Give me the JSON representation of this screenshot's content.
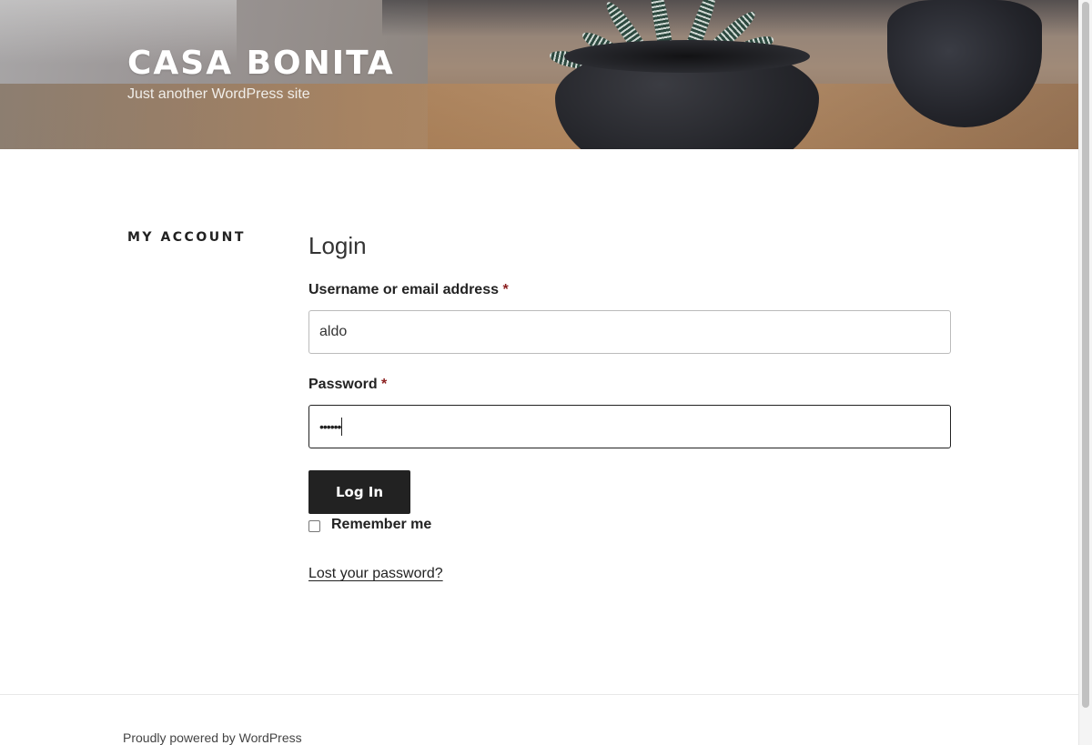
{
  "header": {
    "site_title": "CASA BONITA",
    "site_description": "Just another WordPress site"
  },
  "content": {
    "page_title": "MY ACCOUNT",
    "login_heading": "Login",
    "username_label": "Username or email address",
    "username_value": "aldo",
    "password_label": "Password",
    "password_masked": "••••••",
    "required_marker": "*",
    "login_button_label": "Log In",
    "remember_me_label": "Remember me",
    "remember_me_checked": false,
    "lost_password_link": "Lost your password?"
  },
  "footer": {
    "powered_by": "Proudly powered by WordPress"
  },
  "colors": {
    "button_bg": "#222222",
    "required_marker": "#8b1f1f",
    "text": "#222222"
  },
  "icons": {
    "checkbox": "checkbox-unchecked"
  }
}
